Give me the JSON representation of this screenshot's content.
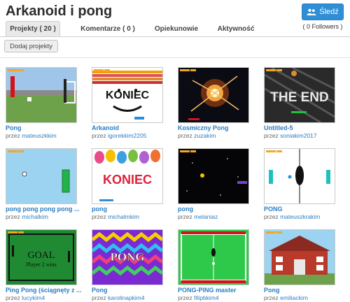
{
  "studio": {
    "title": "Arkanoid i pong"
  },
  "follow": {
    "label": "Śledź",
    "followers": "( 0 Followers )"
  },
  "tabs": [
    {
      "label": "Projekty ( 20 )",
      "active": true
    },
    {
      "label": "Komentarze ( 0 )",
      "active": false
    },
    {
      "label": "Opiekunowie",
      "active": false
    },
    {
      "label": "Aktywność",
      "active": false
    }
  ],
  "toolbar": {
    "add_label": "Dodaj projekty"
  },
  "by_prefix": "przez",
  "projects": [
    {
      "title": "Pong",
      "author": "mateuszkkim",
      "thumb": "pong-field"
    },
    {
      "title": "Arkanoid",
      "author": "igorekkim2205",
      "thumb": "koniec-face",
      "text": "KONIEC"
    },
    {
      "title": "Kosmiczny Pong",
      "author": "zuzakim",
      "thumb": "space-blast"
    },
    {
      "title": "Untitled-5",
      "author": "soniakim2017",
      "thumb": "the-end",
      "text": "THE END"
    },
    {
      "title": "pong pong pong pong ...",
      "author": "michalkim",
      "thumb": "light-blue"
    },
    {
      "title": "pong",
      "author": "michalmkim",
      "thumb": "balloons",
      "text": "KONIEC"
    },
    {
      "title": "pong",
      "author": "melaniaz",
      "thumb": "dark-space"
    },
    {
      "title": "PONG",
      "author": "mateuszkrakim",
      "thumb": "pong-circle"
    },
    {
      "title": "Ping Pong (ściągnęty z ...",
      "author": "lucykim4",
      "thumb": "goal",
      "text": "GOAL",
      "subtext": "Player 2 wins"
    },
    {
      "title": "Pong",
      "author": "karolinapkim4",
      "thumb": "zigzag",
      "text": "PONG"
    },
    {
      "title": "PONG-PING master",
      "author": "filipbkim4",
      "thumb": "green-table"
    },
    {
      "title": "Pong",
      "author": "emiliackim",
      "thumb": "school"
    }
  ],
  "colors": {
    "accent": "#2e8fd6",
    "link": "#2a7ec4"
  }
}
